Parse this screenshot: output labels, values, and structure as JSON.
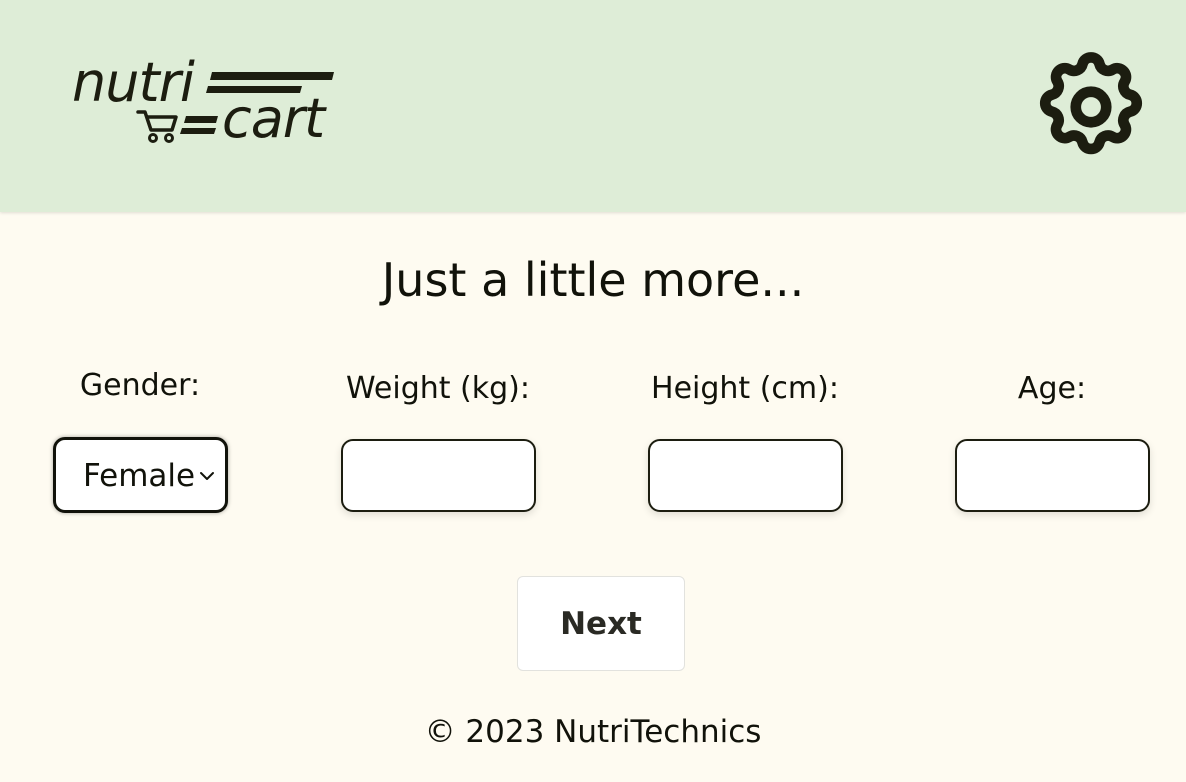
{
  "header": {
    "logo": {
      "line1": "nutri",
      "line2": "cart"
    },
    "settings_icon": "gear-icon"
  },
  "main": {
    "heading": "Just a little more...",
    "fields": {
      "gender": {
        "label": "Gender:",
        "selected": "Female"
      },
      "weight": {
        "label": "Weight (kg):",
        "value": ""
      },
      "height": {
        "label": "Height (cm):",
        "value": ""
      },
      "age": {
        "label": "Age:",
        "value": ""
      }
    },
    "next_label": "Next"
  },
  "footer": {
    "copyright": "© 2023 NutriTechnics"
  },
  "colors": {
    "header_bg": "#deedd7",
    "page_bg": "#fefbf1",
    "text": "#1c1d10"
  }
}
